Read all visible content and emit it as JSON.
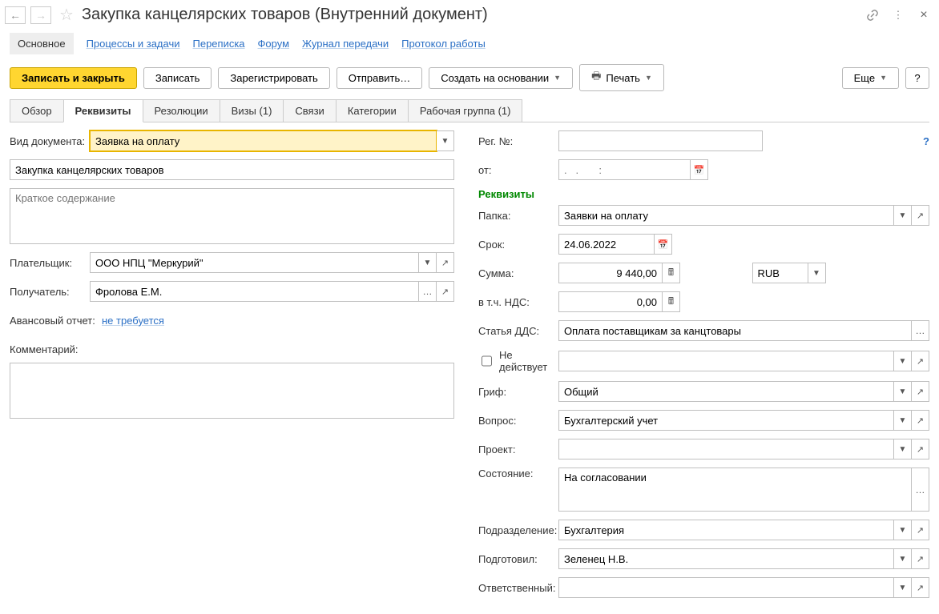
{
  "header": {
    "title": "Закупка канцелярских товаров (Внутренний документ)"
  },
  "nav": {
    "main": "Основное",
    "processes": "Процессы и задачи",
    "mail": "Переписка",
    "forum": "Форум",
    "journal": "Журнал передачи",
    "protocol": "Протокол работы"
  },
  "toolbar": {
    "save_close": "Записать и закрыть",
    "save": "Записать",
    "register": "Зарегистрировать",
    "send": "Отправить…",
    "create_based": "Создать на основании",
    "print": "Печать",
    "more": "Еще",
    "help": "?"
  },
  "tabs": {
    "overview": "Обзор",
    "requisites": "Реквизиты",
    "resolutions": "Резолюции",
    "visas": "Визы (1)",
    "links": "Связи",
    "categories": "Категории",
    "workgroup": "Рабочая группа (1)"
  },
  "left": {
    "doc_type_label": "Вид документа:",
    "doc_type_value": "Заявка на оплату",
    "name_value": "Закупка канцелярских товаров",
    "summary_placeholder": "Краткое содержание",
    "payer_label": "Плательщик:",
    "payer_value": "ООО НПЦ \"Меркурий\"",
    "recipient_label": "Получатель:",
    "recipient_value": "Фролова Е.М.",
    "advance_label": "Авансовый отчет:",
    "advance_link": "не требуется",
    "comment_label": "Комментарий:"
  },
  "right": {
    "reg_label": "Рег. №:",
    "from_label": "от:",
    "date_placeholder": ".   .       :",
    "section": "Реквизиты",
    "folder_label": "Папка:",
    "folder_value": "Заявки на оплату",
    "due_label": "Срок:",
    "due_value": "24.06.2022",
    "sum_label": "Сумма:",
    "sum_value": "9 440,00",
    "currency": "RUB",
    "vat_label": "в т.ч. НДС:",
    "vat_value": "0,00",
    "dds_label": "Статья ДДС:",
    "dds_value": "Оплата поставщикам за канцтовары",
    "inactive_label": "Не действует",
    "grif_label": "Гриф:",
    "grif_value": "Общий",
    "question_label": "Вопрос:",
    "question_value": "Бухгалтерский учет",
    "project_label": "Проект:",
    "project_value": "",
    "state_label": "Состояние:",
    "state_value": "На согласовании",
    "dept_label": "Подразделение:",
    "dept_value": "Бухгалтерия",
    "prepared_label": "Подготовил:",
    "prepared_value": "Зеленец Н.В.",
    "responsible_label": "Ответственный:",
    "responsible_value": ""
  }
}
